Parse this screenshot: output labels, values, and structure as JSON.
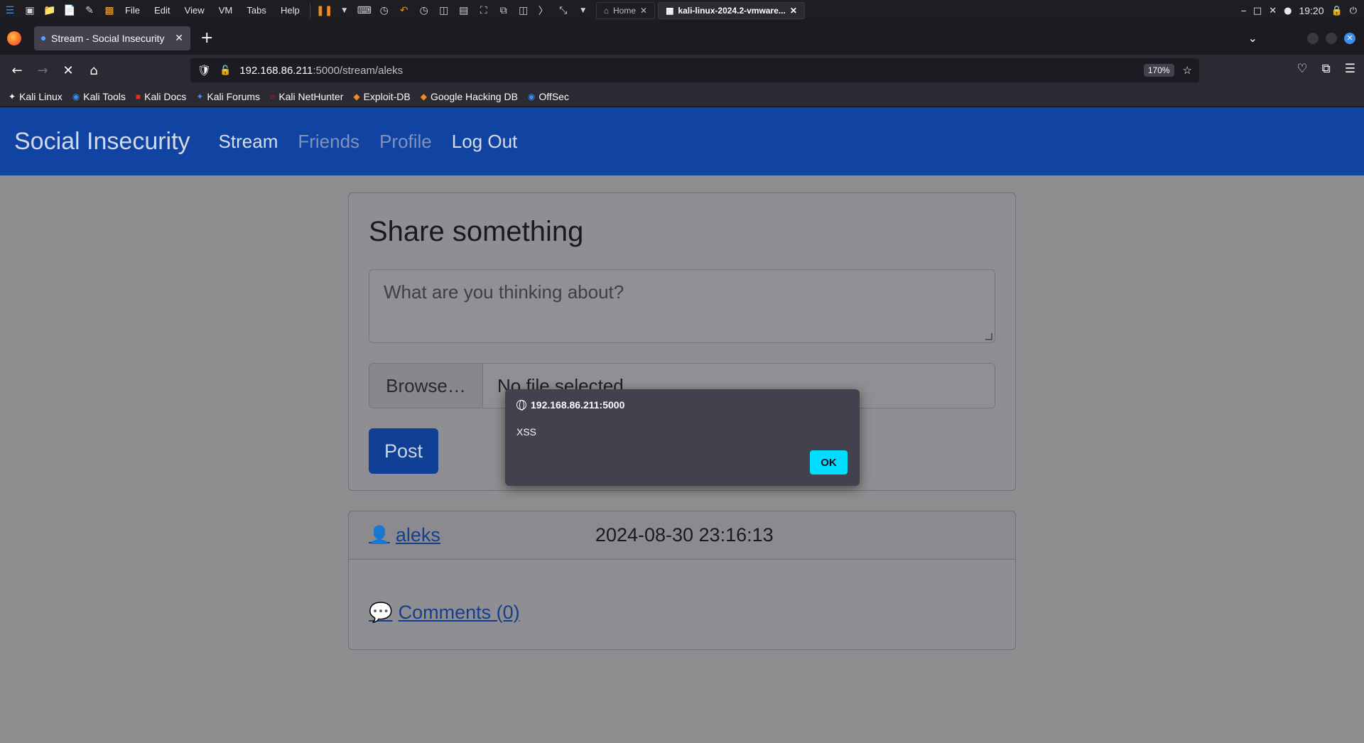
{
  "os_panel": {
    "menus": [
      "File",
      "Edit",
      "View",
      "VM",
      "Tabs",
      "Help"
    ],
    "tabs": [
      {
        "label": "Home"
      },
      {
        "label": "kali-linux-2024.2-vmware..."
      }
    ],
    "clock": "19:20"
  },
  "browser": {
    "tab_title": "Stream - Social Insecurity",
    "url_host": "192.168.86.211",
    "url_path": ":5000/stream/aleks",
    "zoom": "170%",
    "bookmarks": [
      "Kali Linux",
      "Kali Tools",
      "Kali Docs",
      "Kali Forums",
      "Kali NetHunter",
      "Exploit-DB",
      "Google Hacking DB",
      "OffSec"
    ]
  },
  "site": {
    "brand": "Social Insecurity",
    "nav": {
      "stream": "Stream",
      "friends": "Friends",
      "profile": "Profile",
      "logout": "Log Out"
    }
  },
  "share": {
    "title": "Share something",
    "placeholder": "What are you thinking about?",
    "browse_label": "Browse…",
    "file_status": "No file selected.",
    "post_label": "Post"
  },
  "post": {
    "author": "aleks",
    "date": "2024-08-30 23:16:13",
    "comments_label": "Comments (0)"
  },
  "alert": {
    "origin": "192.168.86.211:5000",
    "message": "XSS",
    "ok_label": "OK"
  },
  "colors": {
    "site_nav": "#1144a2",
    "alert_ok": "#00ddff",
    "link": "#153e8c"
  }
}
